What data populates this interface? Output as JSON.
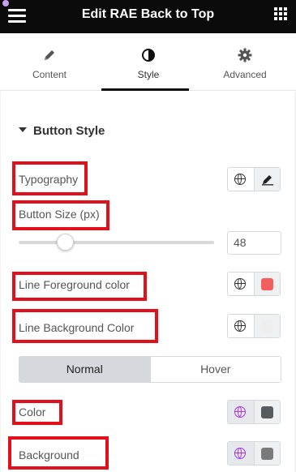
{
  "header": {
    "title": "Edit RAE Back to Top"
  },
  "tabs": [
    {
      "label": "Content",
      "icon": "pencil-icon"
    },
    {
      "label": "Style",
      "icon": "half-circle-icon"
    },
    {
      "label": "Advanced",
      "icon": "gear-icon"
    }
  ],
  "section": {
    "title": "Button Style"
  },
  "controls": {
    "typography": "Typography",
    "button_size": "Button Size (px)",
    "button_size_value": "48",
    "line_fg": "Line Foreground color",
    "line_bg": "Line Background Color",
    "color": "Color",
    "background": "Background"
  },
  "state_tabs": {
    "normal": "Normal",
    "hover": "Hover"
  },
  "colors": {
    "line_fg_swatch": "#f25f5c",
    "line_bg_swatch": "#eeeeee",
    "color_swatch": "#555b61",
    "background_swatch": "#7a7a7a",
    "highlight": "#e1101a"
  }
}
